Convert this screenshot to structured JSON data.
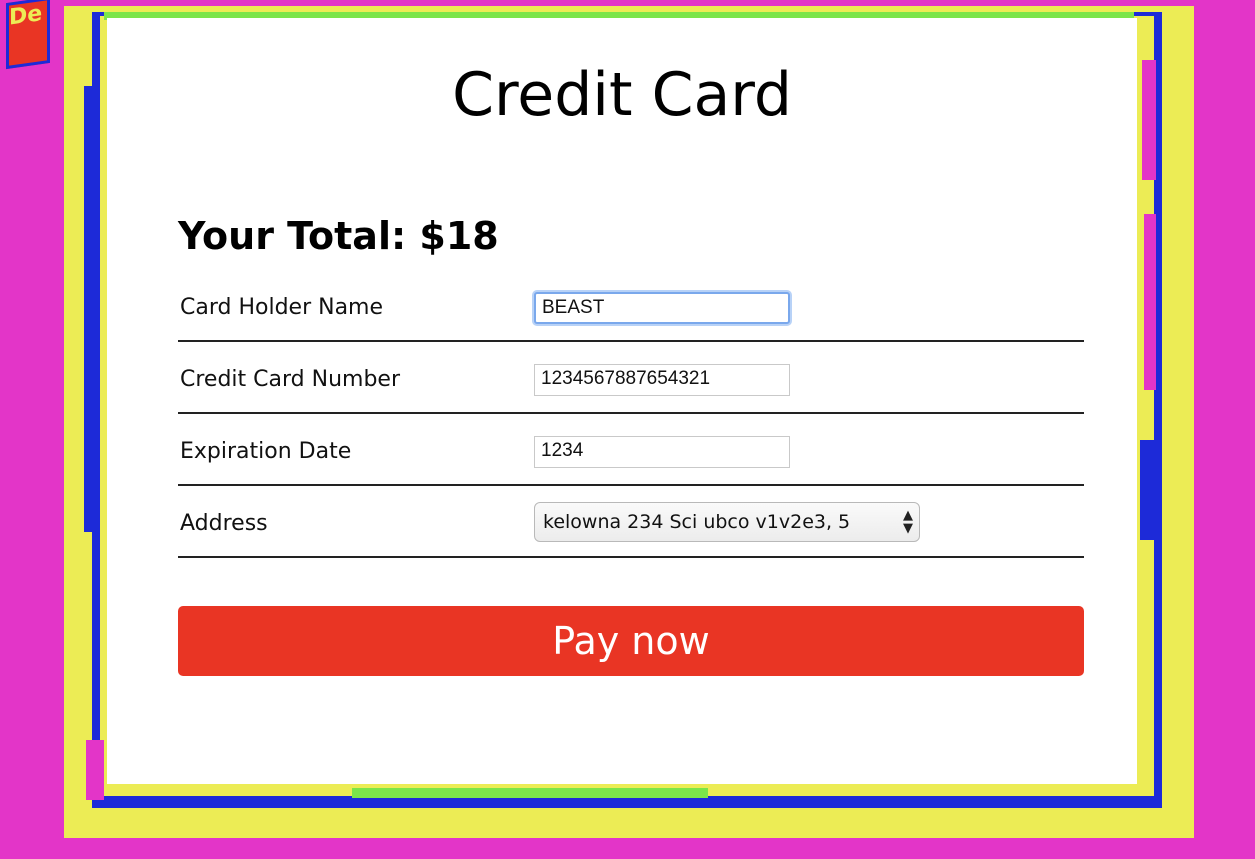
{
  "page": {
    "title": "Credit Card",
    "total_label": "Your Total: $18",
    "corner_badge_text": "De"
  },
  "form": {
    "fields": [
      {
        "label": "Card Holder Name",
        "value": "BEAST",
        "focused": true
      },
      {
        "label": "Credit Card Number",
        "value": "1234567887654321"
      },
      {
        "label": "Expiration Date",
        "value": "1234"
      }
    ],
    "address": {
      "label": "Address",
      "selected": "kelowna 234 Sci ubco v1v2e3, 5"
    },
    "submit_label": "Pay now"
  },
  "colors": {
    "background": "#e335c8",
    "frame_yellow": "#ecec55",
    "frame_blue": "#1d2ad8",
    "frame_green": "#7be54a",
    "pay_button": "#e93524"
  }
}
